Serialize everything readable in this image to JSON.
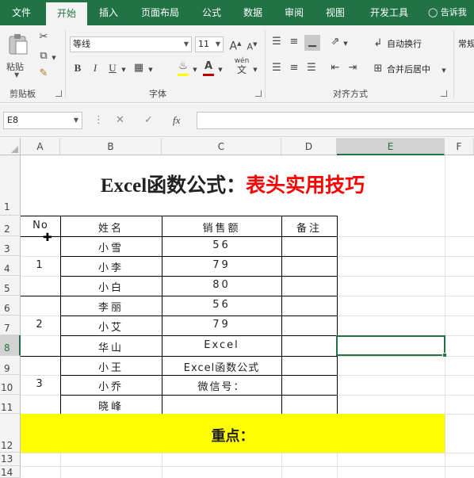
{
  "ribbon": {
    "tabs": [
      "文件",
      "开始",
      "插入",
      "页面布局",
      "公式",
      "数据",
      "审阅",
      "视图",
      "开发工具"
    ],
    "tell_me": "告诉我",
    "clipboard": {
      "paste": "粘贴",
      "label": "剪贴板"
    },
    "font": {
      "name": "等线",
      "size": "11",
      "grow": "A",
      "shrink": "A",
      "bold": "B",
      "italic": "I",
      "underline": "U",
      "color_letter": "A",
      "phonetic": "wén",
      "label": "字体",
      "font_color": "#c00000"
    },
    "alignment": {
      "wrap_text": "自动换行",
      "merge_center": "合并后居中",
      "label": "对齐方式"
    },
    "number": {
      "format": "常规"
    }
  },
  "formula_bar": {
    "name_box": "E8",
    "fx": "fx",
    "formula": ""
  },
  "sheet": {
    "columns": [
      "A",
      "B",
      "C",
      "D",
      "E",
      "F"
    ],
    "rows": [
      "1",
      "2",
      "3",
      "4",
      "5",
      "6",
      "7",
      "8",
      "9",
      "10",
      "11",
      "12",
      "13",
      "14"
    ],
    "selected_cell": "E8",
    "title_black": "Excel函数公式：",
    "title_red": "表头实用技巧",
    "headers": {
      "no": "No",
      "name": "姓名",
      "sales": "销售额",
      "note": "备注"
    },
    "groups": [
      "1",
      "2",
      "3"
    ],
    "names": [
      "小雪",
      "小李",
      "小白",
      "李丽",
      "小艾",
      "华山",
      "小王",
      "小乔",
      "晓峰"
    ],
    "sales": [
      "56",
      "79",
      "80",
      "56",
      "79",
      "Excel",
      "Excel函数公式",
      "微信号：",
      ""
    ],
    "highlight_text": "重点：",
    "highlight_color": "#ffff00",
    "accent": "#217346"
  }
}
